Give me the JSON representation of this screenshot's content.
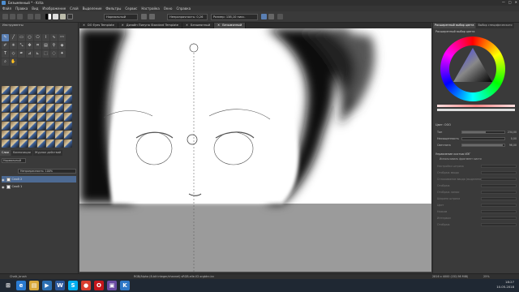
{
  "window": {
    "title": "Безымянный * - Krita"
  },
  "menu": [
    "Файл",
    "Правка",
    "Вид",
    "Изображение",
    "Слой",
    "Выделение",
    "Фильтры",
    "Сервис",
    "Настройка",
    "Окно",
    "Справка"
  ],
  "toolbar": {
    "blend_mode": "Нормальный",
    "opacity_label": "Непрозрачность: 0,26",
    "size_label": "Размер: 138,10 пикс."
  },
  "left_dock": {
    "toolbox_title": "Инструменты",
    "tabs": [
      "Слои",
      "Композиции",
      "Журнал действий"
    ],
    "layers_opacity": "Непрозрачность: 100%",
    "layers_blend": "Нормальный",
    "layers": [
      {
        "name": "Слой 2",
        "selected": true
      },
      {
        "name": "Слой 1",
        "selected": false
      }
    ]
  },
  "doc_tabs": [
    "DO Eyes Template",
    "Дизайн Пинупа Standard Template",
    "Безымянный",
    "Безымянный"
  ],
  "right_dock": {
    "tabs": [
      "Расширенный выбор цвета",
      "Выбор специфического"
    ],
    "color_section": "Расширенный выбор цвета",
    "props_title": "Цвет: ООО",
    "props": [
      {
        "label": "Тон",
        "value": "234,00",
        "fill": 0.55
      },
      {
        "label": "Насыщенность",
        "value": "0,00",
        "fill": 0.0
      },
      {
        "label": "Светлота",
        "value": "96,00",
        "fill": 0.96
      }
    ],
    "tool_options": "Управление кистью ИЭГ",
    "tool_options_sub": "Использовать фрагмент кисти",
    "dim_rows": [
      "Настройки штриха",
      "Отображ ввода",
      "Сглаживание ввода (выделения)",
      "Отображ",
      "Отображ линии",
      "Ширина штриха",
      "Цвет",
      "Нажим",
      "Интервал",
      "Отображ"
    ]
  },
  "status": {
    "brush_name": "Chalk_brush",
    "color_space": "RGB/Alpha (8-bit integer/channel) sRGB-elle-V2-srgbtrc.icc",
    "dimensions": "2816 x 4000 (152,98 MiB)",
    "zoom": "25%"
  },
  "taskbar": {
    "time": "18:27",
    "date": "10.05.2018",
    "apps": [
      {
        "icon": "windows-start-icon",
        "label": "⊞",
        "color": "#1f2833"
      },
      {
        "icon": "ie-icon",
        "label": "e",
        "color": "#2a7bd1"
      },
      {
        "icon": "explorer-icon",
        "label": "▤",
        "color": "#d8a93b"
      },
      {
        "icon": "media-icon",
        "label": "▶",
        "color": "#2b6fb1"
      },
      {
        "icon": "word-icon",
        "label": "W",
        "color": "#2b579a"
      },
      {
        "icon": "skype-icon",
        "label": "S",
        "color": "#00aff0"
      },
      {
        "icon": "chrome-icon",
        "label": "●",
        "color": "#d93e30"
      },
      {
        "icon": "opera-icon",
        "label": "O",
        "color": "#c4161c"
      },
      {
        "icon": "photo-icon",
        "label": "▣",
        "color": "#6a4ca3"
      },
      {
        "icon": "krita-icon",
        "label": "K",
        "color": "#2e78c7"
      }
    ]
  },
  "colors": {
    "accent": "#4d6a93",
    "panel": "#3a3a3a",
    "canvas_bg": "#9b9b9b"
  }
}
